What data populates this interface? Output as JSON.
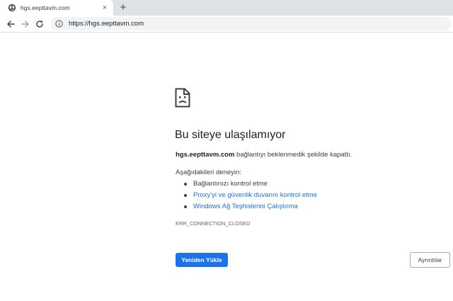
{
  "tab": {
    "title": "hgs.eepttavm.com",
    "close_glyph": "×",
    "favicon": "globe-icon"
  },
  "toolbar": {
    "back_icon": "back-arrow-icon",
    "forward_icon": "forward-arrow-icon",
    "reload_icon": "reload-icon",
    "new_tab_glyph": "+",
    "url": "https://hgs.eepttavm.com",
    "url_icon": "info-icon"
  },
  "error": {
    "icon": "sad-page-icon",
    "title": "Bu siteye ulaşılamıyor",
    "host": "hgs.eepttavm.com",
    "description": " bağlantıyı beklenmedik şekilde kapattı.",
    "suggestions_heading": "Aşağıdakileri deneyin:",
    "suggestions": [
      {
        "label": "Bağlantınızı kontrol etme",
        "link": false
      },
      {
        "label": "Proxy'yi ve güvenlik duvarını kontrol etme",
        "link": true
      },
      {
        "label": "Windows Ağ Teşhislerini Çalıştırma",
        "link": true
      }
    ],
    "code": "ERR_CONNECTION_CLOSED",
    "reload_label": "Yeniden Yükle",
    "details_label": "Ayrıntılar"
  },
  "colors": {
    "accent": "#1a73e8",
    "tabstrip": "#dee1e6",
    "omnibox": "#f1f3f4",
    "text": "#202124"
  }
}
